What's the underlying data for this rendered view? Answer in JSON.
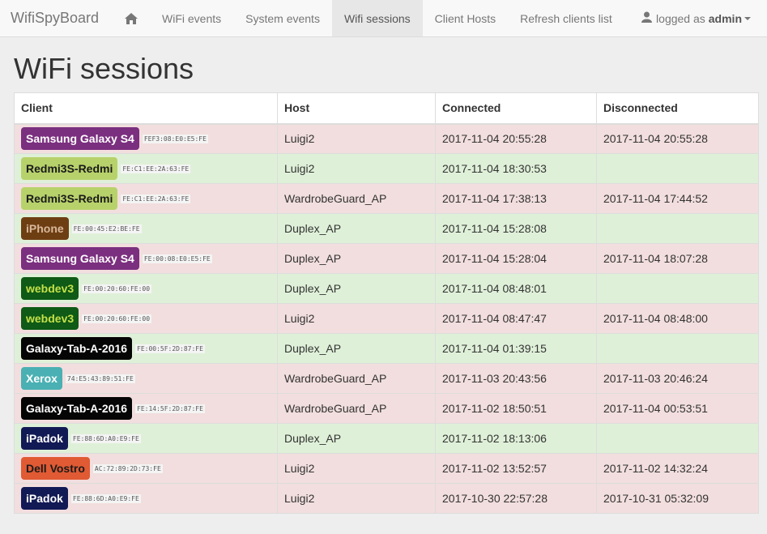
{
  "navbar": {
    "brand": "WifiSpyBoard",
    "items": [
      {
        "label": "WiFi events"
      },
      {
        "label": "System events"
      },
      {
        "label": "Wifi sessions",
        "active": true
      },
      {
        "label": "Client Hosts"
      },
      {
        "label": "Refresh clients list"
      }
    ],
    "user_prefix": "logged as",
    "user_name": "admin"
  },
  "page": {
    "title": "WiFi sessions"
  },
  "table": {
    "headers": [
      "Client",
      "Host",
      "Connected",
      "Disconnected"
    ],
    "rows": [
      {
        "client": "Samsung Galaxy S4",
        "mac": "FEF3:08:E0:E5:FE",
        "color": "#7b2f7f",
        "text_color": "#ffffff",
        "host": "Luigi2",
        "connected": "2017-11-04 20:55:28",
        "disconnected": "2017-11-04 20:55:28",
        "status": "danger"
      },
      {
        "client": "Redmi3S-Redmi",
        "mac": "FE:C1:EE:2A:63:FE",
        "color": "#b8d26b",
        "text_color": "#1a1a1a",
        "host": "Luigi2",
        "connected": "2017-11-04 18:30:53",
        "disconnected": "",
        "status": "success"
      },
      {
        "client": "Redmi3S-Redmi",
        "mac": "FE:C1:EE:2A:63:FE",
        "color": "#b8d26b",
        "text_color": "#1a1a1a",
        "host": "WardrobeGuard_AP",
        "connected": "2017-11-04 17:38:13",
        "disconnected": "2017-11-04 17:44:52",
        "status": "danger"
      },
      {
        "client": "iPhone",
        "mac": "FE:00:45:E2:BE:FE",
        "color": "#6e3e13",
        "text_color": "#d8b89a",
        "host": "Duplex_AP",
        "connected": "2017-11-04 15:28:08",
        "disconnected": "",
        "status": "success"
      },
      {
        "client": "Samsung Galaxy S4",
        "mac": "FE:00:08:E0:E5:FE",
        "color": "#7b2f7f",
        "text_color": "#ffffff",
        "host": "Duplex_AP",
        "connected": "2017-11-04 15:28:04",
        "disconnected": "2017-11-04 18:07:28",
        "status": "danger"
      },
      {
        "client": "webdev3",
        "mac": "FE:00:20:60:FE:00",
        "color": "#0e5a16",
        "text_color": "#c4e04a",
        "host": "Duplex_AP",
        "connected": "2017-11-04 08:48:01",
        "disconnected": "",
        "status": "success"
      },
      {
        "client": "webdev3",
        "mac": "FE:00:20:60:FE:00",
        "color": "#0e5a16",
        "text_color": "#c4e04a",
        "host": "Luigi2",
        "connected": "2017-11-04 08:47:47",
        "disconnected": "2017-11-04 08:48:00",
        "status": "danger"
      },
      {
        "client": "Galaxy-Tab-A-2016",
        "mac": "FE:00:5F:2D:87:FE",
        "color": "#050505",
        "text_color": "#ffffff",
        "host": "Duplex_AP",
        "connected": "2017-11-04 01:39:15",
        "disconnected": "",
        "status": "success"
      },
      {
        "client": "Xerox",
        "mac": "74:E5:43:89:51:FE",
        "color": "#4ab0b3",
        "text_color": "#ffffff",
        "host": "WardrobeGuard_AP",
        "connected": "2017-11-03 20:43:56",
        "disconnected": "2017-11-03 20:46:24",
        "status": "danger"
      },
      {
        "client": "Galaxy-Tab-A-2016",
        "mac": "FE:14:5F:2D:87:FE",
        "color": "#050505",
        "text_color": "#ffffff",
        "host": "WardrobeGuard_AP",
        "connected": "2017-11-02 18:50:51",
        "disconnected": "2017-11-04 00:53:51",
        "status": "danger"
      },
      {
        "client": "iPadok",
        "mac": "FE:88:6D:A0:E9:FE",
        "color": "#121a55",
        "text_color": "#ffffff",
        "host": "Duplex_AP",
        "connected": "2017-11-02 18:13:06",
        "disconnected": "",
        "status": "success"
      },
      {
        "client": "Dell Vostro",
        "mac": "AC:72:89:2D:73:FE",
        "color": "#e05a33",
        "text_color": "#1a1a1a",
        "host": "Luigi2",
        "connected": "2017-11-02 13:52:57",
        "disconnected": "2017-11-02 14:32:24",
        "status": "danger"
      },
      {
        "client": "iPadok",
        "mac": "FE:88:6D:A0:E9:FE",
        "color": "#121a55",
        "text_color": "#ffffff",
        "host": "Luigi2",
        "connected": "2017-10-30 22:57:28",
        "disconnected": "2017-10-31 05:32:09",
        "status": "danger"
      }
    ]
  }
}
